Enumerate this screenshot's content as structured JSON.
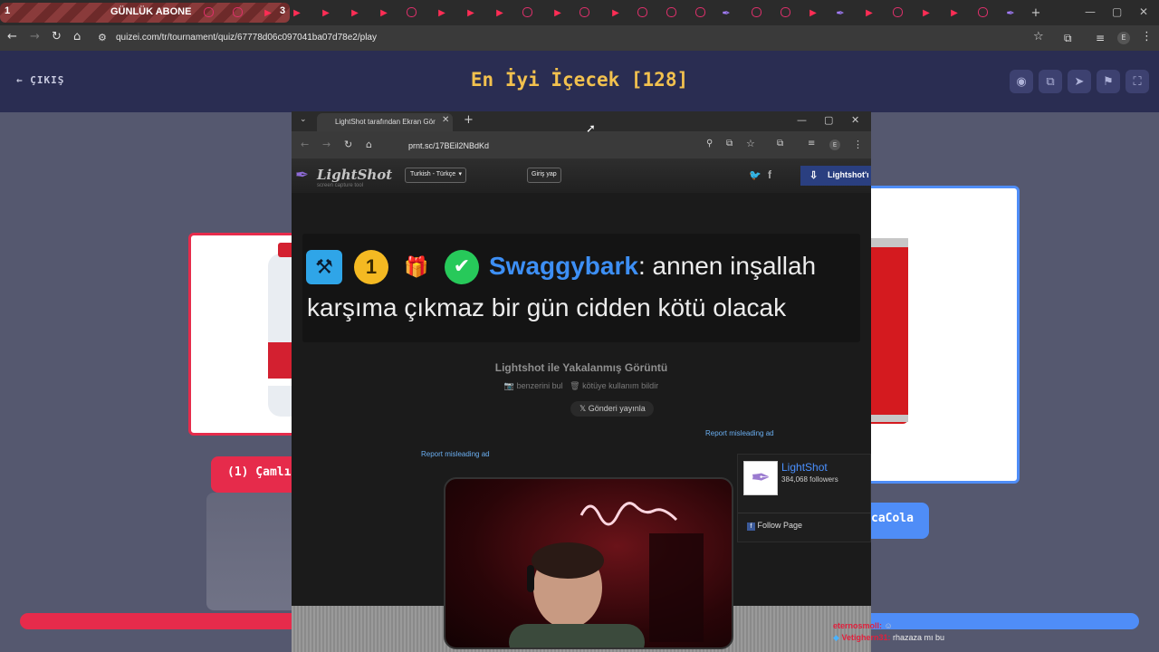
{
  "browser": {
    "first_tab": {
      "number": "1",
      "label": "GÜNLÜK ABONE",
      "counter": "3"
    },
    "url": "quizei.com/tr/tournament/quiz/67778d06c097041ba07d78e2/play",
    "profile_initial": "E"
  },
  "page": {
    "exit_label": "ÇIKIŞ",
    "title": "En İyi İçecek [128]",
    "left_choice_label": "(1) Çamlı",
    "right_choice_label": "caCola",
    "accent_left": "#e62b4b",
    "accent_right": "#4f8df7",
    "title_color": "#f2c14e"
  },
  "popup": {
    "tab_title": "LightShot tarafından Ekran Gör",
    "url": "prnt.sc/17BEil2NBdKd",
    "profile_initial": "E",
    "site": {
      "logo_text": "LightShot",
      "logo_subtitle": "screen capture tool",
      "language": "Turkish - Türkçe",
      "login_label": "Giriş yap",
      "app_button": "Lightshot'ı"
    },
    "capture": {
      "badge_number": "1",
      "username": "Swaggybark",
      "line1_rest": ": annen inşallah",
      "line2": "karşıma çıkmaz bir gün cidden kötü olacak"
    },
    "caption": "Lightshot ile Yakalanmış Görüntü",
    "find_similar": "benzerini bul",
    "report_abuse": "kötüye kullanım bildir",
    "tweet_label": "Gönderi yayınla",
    "report_ad_1": "Report misleading ad",
    "report_ad_2": "Report misleading ad",
    "fb": {
      "name": "LightShot",
      "followers": "384,068 followers",
      "follow_label": "Follow Page"
    }
  },
  "chat": [
    {
      "user": "eternosmoll:",
      "message": ""
    },
    {
      "user": "Vetighern31:",
      "message": "rhazaza mı bu"
    }
  ]
}
